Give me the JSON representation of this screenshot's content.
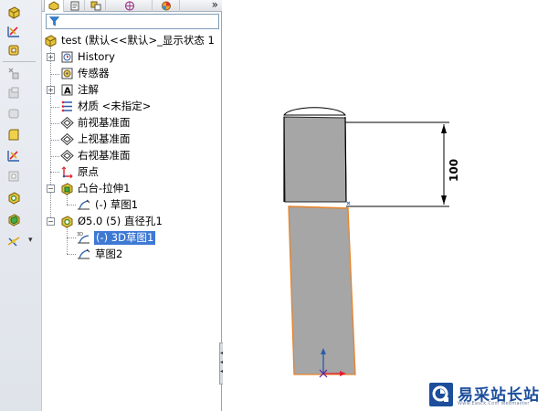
{
  "toolbar_icons": [
    "extrude-boss-icon",
    "revolve-icon",
    "sweep-icon",
    "loft-icon",
    "boundary-icon",
    "cut-icon",
    "fillet-icon",
    "rib-icon",
    "draft-icon",
    "hole-icon",
    "shell-icon",
    "reference-geometry-icon"
  ],
  "panel": {
    "tabs": [
      "feature-manager-tab",
      "property-manager-tab",
      "configuration-manager-tab",
      "dimxpert-tab",
      "display-manager-tab"
    ],
    "expand_glyph": "»"
  },
  "tree": {
    "root": "test  (默认<<默认>_显示状态 1",
    "history": "History",
    "sensors": "传感器",
    "annotations": "注解",
    "material": "材质 <未指定>",
    "front_plane": "前视基准面",
    "top_plane": "上视基准面",
    "right_plane": "右视基准面",
    "origin": "原点",
    "boss_extrude": "凸台-拉伸1",
    "boss_sketch": "(-) 草图1",
    "hole": "Ø5.0 (5) 直径孔1",
    "hole_3dsketch": "(-) 3D草图1",
    "hole_sketch": "草图2"
  },
  "graphics": {
    "dimension_value": "100",
    "body_color": "#a6a6a6",
    "highlight_color": "#e8832a"
  },
  "watermark": {
    "title": "易采站长站",
    "subtitle": "Www.Easck.Com  Webmaster"
  }
}
